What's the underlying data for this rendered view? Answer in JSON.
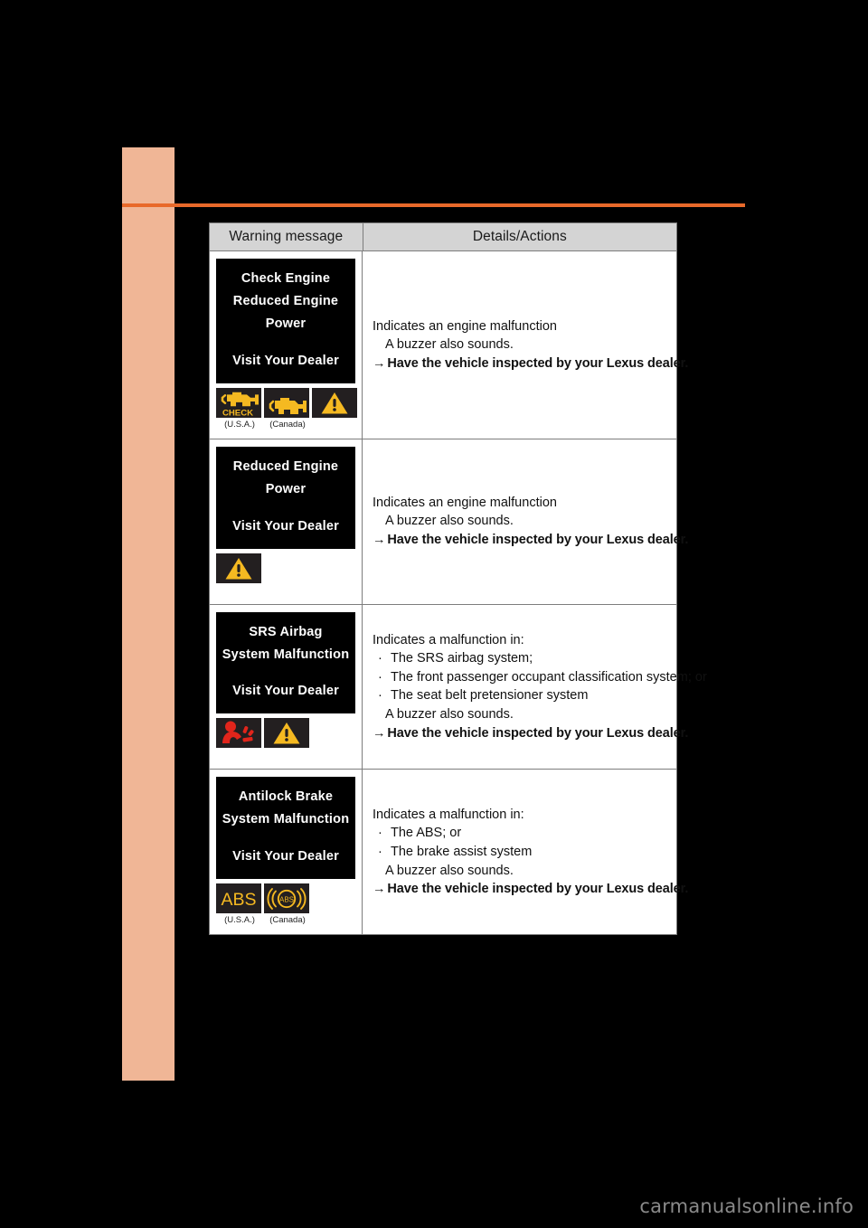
{
  "page": {
    "watermark": "carmanualsonline.info",
    "accent_orange": "#e8692a",
    "side_tab_color": "#f0b696"
  },
  "table": {
    "headers": {
      "warning_message": "Warning message",
      "details_actions": "Details/Actions"
    },
    "rows": [
      {
        "display": {
          "lines": [
            "Check Engine",
            "Reduced Engine",
            "Power"
          ],
          "footer": "Visit Your Dealer"
        },
        "indicators": [
          {
            "icon": "check-engine-usa-icon",
            "caption": "(U.S.A.)"
          },
          {
            "icon": "check-engine-canada-icon",
            "caption": "(Canada)"
          },
          {
            "icon": "master-warning-triangle-icon",
            "caption": ""
          }
        ],
        "details": [
          {
            "text": "Indicates an engine malfunction",
            "style": "plain"
          },
          {
            "text": "A buzzer also sounds.",
            "style": "indent"
          },
          {
            "text": "Have the vehicle inspected by your Lexus dealer.",
            "style": "action",
            "arrow": "→"
          }
        ]
      },
      {
        "display": {
          "lines": [
            "Reduced Engine",
            "Power"
          ],
          "footer": "Visit Your Dealer"
        },
        "indicators": [
          {
            "icon": "master-warning-triangle-icon",
            "caption": ""
          }
        ],
        "details": [
          {
            "text": "Indicates an engine malfunction",
            "style": "plain"
          },
          {
            "text": "A buzzer also sounds.",
            "style": "indent"
          },
          {
            "text": "Have the vehicle inspected by your Lexus dealer.",
            "style": "action",
            "arrow": "→"
          }
        ]
      },
      {
        "display": {
          "lines": [
            "SRS Airbag",
            "System Malfunction"
          ],
          "footer": "Visit Your Dealer"
        },
        "indicators": [
          {
            "icon": "srs-airbag-icon",
            "caption": ""
          },
          {
            "icon": "master-warning-triangle-icon",
            "caption": ""
          }
        ],
        "details": [
          {
            "text": "Indicates a malfunction in:",
            "style": "plain"
          },
          {
            "text": "The SRS airbag system;",
            "style": "bullet",
            "bullet": "·"
          },
          {
            "text": "The front passenger occupant classification system; or",
            "style": "bullet",
            "bullet": "·"
          },
          {
            "text": "The seat belt pretensioner system",
            "style": "bullet",
            "bullet": "·"
          },
          {
            "text": "A buzzer also sounds.",
            "style": "indent"
          },
          {
            "text": "Have the vehicle inspected by your Lexus dealer.",
            "style": "action",
            "arrow": "→"
          }
        ]
      },
      {
        "display": {
          "lines": [
            "Antilock Brake",
            "System Malfunction"
          ],
          "footer": "Visit Your Dealer"
        },
        "indicators": [
          {
            "icon": "abs-usa-icon",
            "caption": "(U.S.A.)"
          },
          {
            "icon": "abs-canada-icon",
            "caption": "(Canada)"
          }
        ],
        "details": [
          {
            "text": "Indicates a malfunction in:",
            "style": "plain"
          },
          {
            "text": "The ABS; or",
            "style": "bullet",
            "bullet": "·"
          },
          {
            "text": "The brake assist system",
            "style": "bullet",
            "bullet": "·"
          },
          {
            "text": "A buzzer also sounds.",
            "style": "indent"
          },
          {
            "text": "Have the vehicle inspected by your Lexus dealer.",
            "style": "action",
            "arrow": "→"
          }
        ]
      }
    ]
  },
  "colors": {
    "indicator_amber": "#f5b921",
    "indicator_red": "#e1251b",
    "tile_background": "#231f20"
  }
}
